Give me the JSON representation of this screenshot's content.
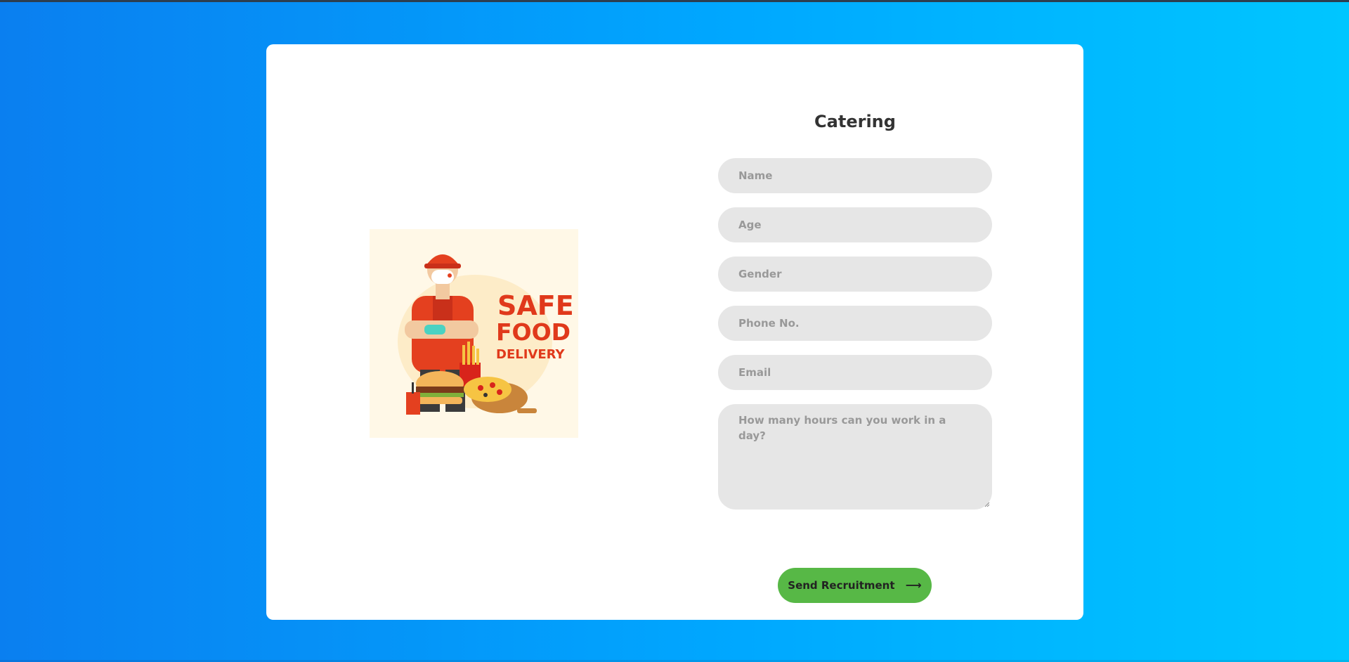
{
  "form": {
    "title": "Catering",
    "name_placeholder": "Name",
    "age_placeholder": "Age",
    "gender_placeholder": "Gender",
    "phone_placeholder": "Phone No.",
    "email_placeholder": "Email",
    "hours_placeholder": "How many hours can you work in a day?",
    "submit_label": "Send Recruitment",
    "submit_icon": "arrow-right-icon"
  },
  "illustration": {
    "line1": "SAFE",
    "line2": "FOOD",
    "line3": "DELIVERY"
  },
  "colors": {
    "background_start": "#0a7ff0",
    "background_end": "#00c6ff",
    "card": "#ffffff",
    "field": "#e6e6e6",
    "placeholder": "#999999",
    "button": "#57b846",
    "headline": "#e0391b"
  }
}
